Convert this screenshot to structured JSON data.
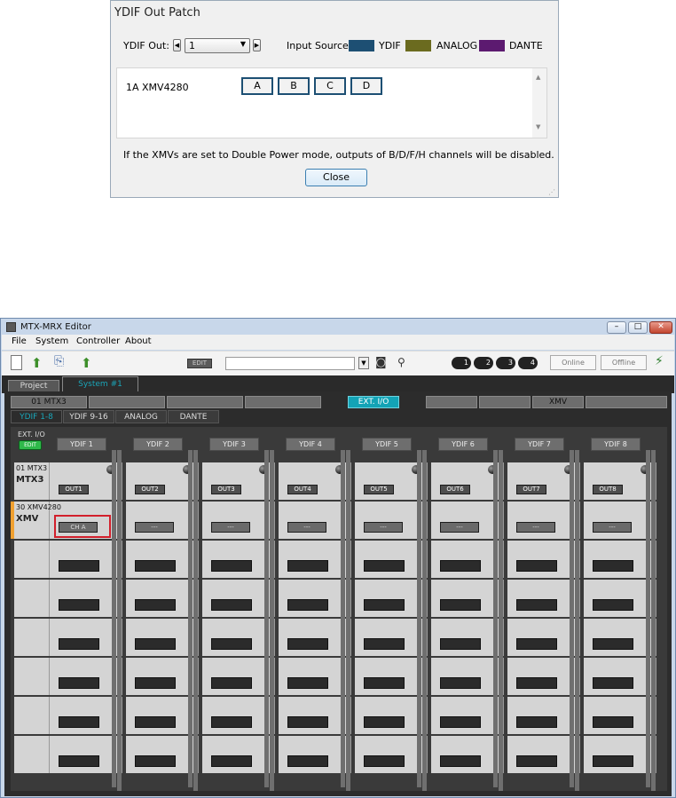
{
  "dialog": {
    "title": "YDIF Out Patch",
    "ydif_out_label": "YDIF Out:",
    "ydif_out_value": "1",
    "input_source_label": "Input Source",
    "legend": [
      {
        "label": "YDIF",
        "color": "#1d4f73"
      },
      {
        "label": "ANALOG",
        "color": "#6b6b1f"
      },
      {
        "label": "DANTE",
        "color": "#5c1a70"
      }
    ],
    "device_label": "1A XMV4280",
    "channels": [
      "A",
      "B",
      "C",
      "D"
    ],
    "note": "If the XMVs are set to Double Power mode, outputs of  B/D/F/H channels will be disabled.",
    "close_label": "Close"
  },
  "window": {
    "title": "MTX-MRX Editor",
    "menus": [
      "File",
      "System",
      "Controller",
      "About"
    ],
    "toolbar": {
      "edit_label": "EDIT",
      "scene_value": "",
      "badges": [
        "1",
        "2",
        "3",
        "4"
      ],
      "online_label": "Online",
      "offline_label": "Offline"
    },
    "tabs": [
      "Project",
      "System #1"
    ],
    "device_tabs": [
      "01 MTX3",
      "",
      "",
      "",
      "EXT. I/O",
      "",
      "",
      "XMV",
      ""
    ],
    "sub_tabs": [
      "YDIF 1-8",
      "YDIF 9-16",
      "ANALOG",
      "DANTE"
    ],
    "ext_io_label": "EXT. I/O",
    "ext_edit_label": "EDIT",
    "ydif_headers": [
      "YDIF 1",
      "YDIF 2",
      "YDIF 3",
      "YDIF 4",
      "YDIF 5",
      "YDIF 6",
      "YDIF 7",
      "YDIF 8"
    ],
    "row_mtx": {
      "id": "01 MTX3",
      "name": "MTX3",
      "outputs": [
        "OUT1",
        "OUT2",
        "OUT3",
        "OUT4",
        "OUT5",
        "OUT6",
        "OUT7",
        "OUT8"
      ]
    },
    "row_xmv": {
      "id": "30 XMV4280",
      "name": "XMV",
      "outputs": [
        "CH A",
        "---",
        "---",
        "---",
        "---",
        "---",
        "---",
        "---"
      ]
    },
    "highlight_color": "#d21f2b",
    "accent_color": "#1aa5b8"
  }
}
